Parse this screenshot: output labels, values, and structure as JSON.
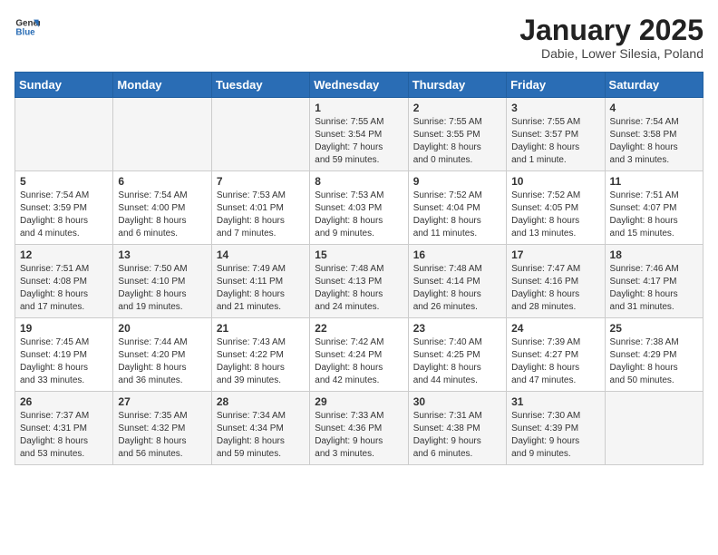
{
  "header": {
    "logo_general": "General",
    "logo_blue": "Blue",
    "month_title": "January 2025",
    "subtitle": "Dabie, Lower Silesia, Poland"
  },
  "weekdays": [
    "Sunday",
    "Monday",
    "Tuesday",
    "Wednesday",
    "Thursday",
    "Friday",
    "Saturday"
  ],
  "weeks": [
    [
      {
        "day": "",
        "info": ""
      },
      {
        "day": "",
        "info": ""
      },
      {
        "day": "",
        "info": ""
      },
      {
        "day": "1",
        "info": "Sunrise: 7:55 AM\nSunset: 3:54 PM\nDaylight: 7 hours\nand 59 minutes."
      },
      {
        "day": "2",
        "info": "Sunrise: 7:55 AM\nSunset: 3:55 PM\nDaylight: 8 hours\nand 0 minutes."
      },
      {
        "day": "3",
        "info": "Sunrise: 7:55 AM\nSunset: 3:57 PM\nDaylight: 8 hours\nand 1 minute."
      },
      {
        "day": "4",
        "info": "Sunrise: 7:54 AM\nSunset: 3:58 PM\nDaylight: 8 hours\nand 3 minutes."
      }
    ],
    [
      {
        "day": "5",
        "info": "Sunrise: 7:54 AM\nSunset: 3:59 PM\nDaylight: 8 hours\nand 4 minutes."
      },
      {
        "day": "6",
        "info": "Sunrise: 7:54 AM\nSunset: 4:00 PM\nDaylight: 8 hours\nand 6 minutes."
      },
      {
        "day": "7",
        "info": "Sunrise: 7:53 AM\nSunset: 4:01 PM\nDaylight: 8 hours\nand 7 minutes."
      },
      {
        "day": "8",
        "info": "Sunrise: 7:53 AM\nSunset: 4:03 PM\nDaylight: 8 hours\nand 9 minutes."
      },
      {
        "day": "9",
        "info": "Sunrise: 7:52 AM\nSunset: 4:04 PM\nDaylight: 8 hours\nand 11 minutes."
      },
      {
        "day": "10",
        "info": "Sunrise: 7:52 AM\nSunset: 4:05 PM\nDaylight: 8 hours\nand 13 minutes."
      },
      {
        "day": "11",
        "info": "Sunrise: 7:51 AM\nSunset: 4:07 PM\nDaylight: 8 hours\nand 15 minutes."
      }
    ],
    [
      {
        "day": "12",
        "info": "Sunrise: 7:51 AM\nSunset: 4:08 PM\nDaylight: 8 hours\nand 17 minutes."
      },
      {
        "day": "13",
        "info": "Sunrise: 7:50 AM\nSunset: 4:10 PM\nDaylight: 8 hours\nand 19 minutes."
      },
      {
        "day": "14",
        "info": "Sunrise: 7:49 AM\nSunset: 4:11 PM\nDaylight: 8 hours\nand 21 minutes."
      },
      {
        "day": "15",
        "info": "Sunrise: 7:48 AM\nSunset: 4:13 PM\nDaylight: 8 hours\nand 24 minutes."
      },
      {
        "day": "16",
        "info": "Sunrise: 7:48 AM\nSunset: 4:14 PM\nDaylight: 8 hours\nand 26 minutes."
      },
      {
        "day": "17",
        "info": "Sunrise: 7:47 AM\nSunset: 4:16 PM\nDaylight: 8 hours\nand 28 minutes."
      },
      {
        "day": "18",
        "info": "Sunrise: 7:46 AM\nSunset: 4:17 PM\nDaylight: 8 hours\nand 31 minutes."
      }
    ],
    [
      {
        "day": "19",
        "info": "Sunrise: 7:45 AM\nSunset: 4:19 PM\nDaylight: 8 hours\nand 33 minutes."
      },
      {
        "day": "20",
        "info": "Sunrise: 7:44 AM\nSunset: 4:20 PM\nDaylight: 8 hours\nand 36 minutes."
      },
      {
        "day": "21",
        "info": "Sunrise: 7:43 AM\nSunset: 4:22 PM\nDaylight: 8 hours\nand 39 minutes."
      },
      {
        "day": "22",
        "info": "Sunrise: 7:42 AM\nSunset: 4:24 PM\nDaylight: 8 hours\nand 42 minutes."
      },
      {
        "day": "23",
        "info": "Sunrise: 7:40 AM\nSunset: 4:25 PM\nDaylight: 8 hours\nand 44 minutes."
      },
      {
        "day": "24",
        "info": "Sunrise: 7:39 AM\nSunset: 4:27 PM\nDaylight: 8 hours\nand 47 minutes."
      },
      {
        "day": "25",
        "info": "Sunrise: 7:38 AM\nSunset: 4:29 PM\nDaylight: 8 hours\nand 50 minutes."
      }
    ],
    [
      {
        "day": "26",
        "info": "Sunrise: 7:37 AM\nSunset: 4:31 PM\nDaylight: 8 hours\nand 53 minutes."
      },
      {
        "day": "27",
        "info": "Sunrise: 7:35 AM\nSunset: 4:32 PM\nDaylight: 8 hours\nand 56 minutes."
      },
      {
        "day": "28",
        "info": "Sunrise: 7:34 AM\nSunset: 4:34 PM\nDaylight: 8 hours\nand 59 minutes."
      },
      {
        "day": "29",
        "info": "Sunrise: 7:33 AM\nSunset: 4:36 PM\nDaylight: 9 hours\nand 3 minutes."
      },
      {
        "day": "30",
        "info": "Sunrise: 7:31 AM\nSunset: 4:38 PM\nDaylight: 9 hours\nand 6 minutes."
      },
      {
        "day": "31",
        "info": "Sunrise: 7:30 AM\nSunset: 4:39 PM\nDaylight: 9 hours\nand 9 minutes."
      },
      {
        "day": "",
        "info": ""
      }
    ]
  ]
}
